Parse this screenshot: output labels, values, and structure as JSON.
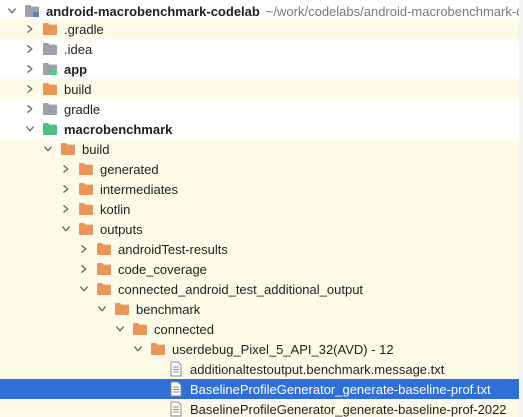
{
  "tree": [
    {
      "label": "android-macrobenchmark-codelab",
      "hint": "~/work/codelabs/android-macrobenchmark-codelab",
      "icon": "module-folder-icon",
      "expanded": true,
      "bold": true,
      "hl": false,
      "selected": false
    },
    {
      "label": ".gradle",
      "icon": "folder-icon-orange",
      "expanded": false,
      "bold": false,
      "hl": true,
      "selected": false
    },
    {
      "label": ".idea",
      "icon": "folder-icon-gray",
      "expanded": false,
      "bold": false,
      "hl": false,
      "selected": false
    },
    {
      "label": "app",
      "icon": "android-module-icon",
      "expanded": false,
      "bold": true,
      "hl": false,
      "selected": false
    },
    {
      "label": "build",
      "icon": "folder-icon-orange",
      "expanded": false,
      "bold": false,
      "hl": true,
      "selected": false
    },
    {
      "label": "gradle",
      "icon": "folder-icon-gray",
      "expanded": false,
      "bold": false,
      "hl": false,
      "selected": false
    },
    {
      "label": "macrobenchmark",
      "icon": "test-module-icon",
      "expanded": true,
      "bold": true,
      "hl": false,
      "selected": false
    },
    {
      "label": "build",
      "icon": "folder-icon-orange",
      "expanded": true,
      "bold": false,
      "hl": true,
      "selected": false
    },
    {
      "label": "generated",
      "icon": "folder-icon-orange",
      "expanded": false,
      "bold": false,
      "hl": true,
      "selected": false
    },
    {
      "label": "intermediates",
      "icon": "folder-icon-orange",
      "expanded": false,
      "bold": false,
      "hl": true,
      "selected": false
    },
    {
      "label": "kotlin",
      "icon": "folder-icon-orange",
      "expanded": false,
      "bold": false,
      "hl": true,
      "selected": false
    },
    {
      "label": "outputs",
      "icon": "folder-icon-orange",
      "expanded": true,
      "bold": false,
      "hl": true,
      "selected": false
    },
    {
      "label": "androidTest-results",
      "icon": "folder-icon-orange",
      "expanded": false,
      "bold": false,
      "hl": true,
      "selected": false
    },
    {
      "label": "code_coverage",
      "icon": "folder-icon-orange",
      "expanded": false,
      "bold": false,
      "hl": true,
      "selected": false
    },
    {
      "label": "connected_android_test_additional_output",
      "icon": "folder-icon-orange",
      "expanded": true,
      "bold": false,
      "hl": true,
      "selected": false
    },
    {
      "label": "benchmark",
      "icon": "folder-icon-orange",
      "expanded": true,
      "bold": false,
      "hl": true,
      "selected": false
    },
    {
      "label": "connected",
      "icon": "folder-icon-orange",
      "expanded": true,
      "bold": false,
      "hl": true,
      "selected": false
    },
    {
      "label": "userdebug_Pixel_5_API_32(AVD) - 12",
      "icon": "folder-icon-orange",
      "expanded": true,
      "bold": false,
      "hl": true,
      "selected": false
    },
    {
      "label": "additionaltestoutput.benchmark.message.txt",
      "icon": "text-file-icon",
      "leaf": true,
      "bold": false,
      "hl": true,
      "selected": false
    },
    {
      "label": "BaselineProfileGenerator_generate-baseline-prof.txt",
      "icon": "text-file-icon",
      "leaf": true,
      "bold": false,
      "hl": false,
      "selected": true
    },
    {
      "label": "BaselineProfileGenerator_generate-baseline-prof-2022",
      "icon": "text-file-icon",
      "leaf": true,
      "bold": false,
      "hl": true,
      "selected": false
    }
  ],
  "colors": {
    "selection": "#2f6fd6",
    "excluded_highlight": "#fdfbe8",
    "folder_orange": "#e8965a",
    "folder_gray": "#9aa1a8",
    "module_green": "#4fc083"
  }
}
